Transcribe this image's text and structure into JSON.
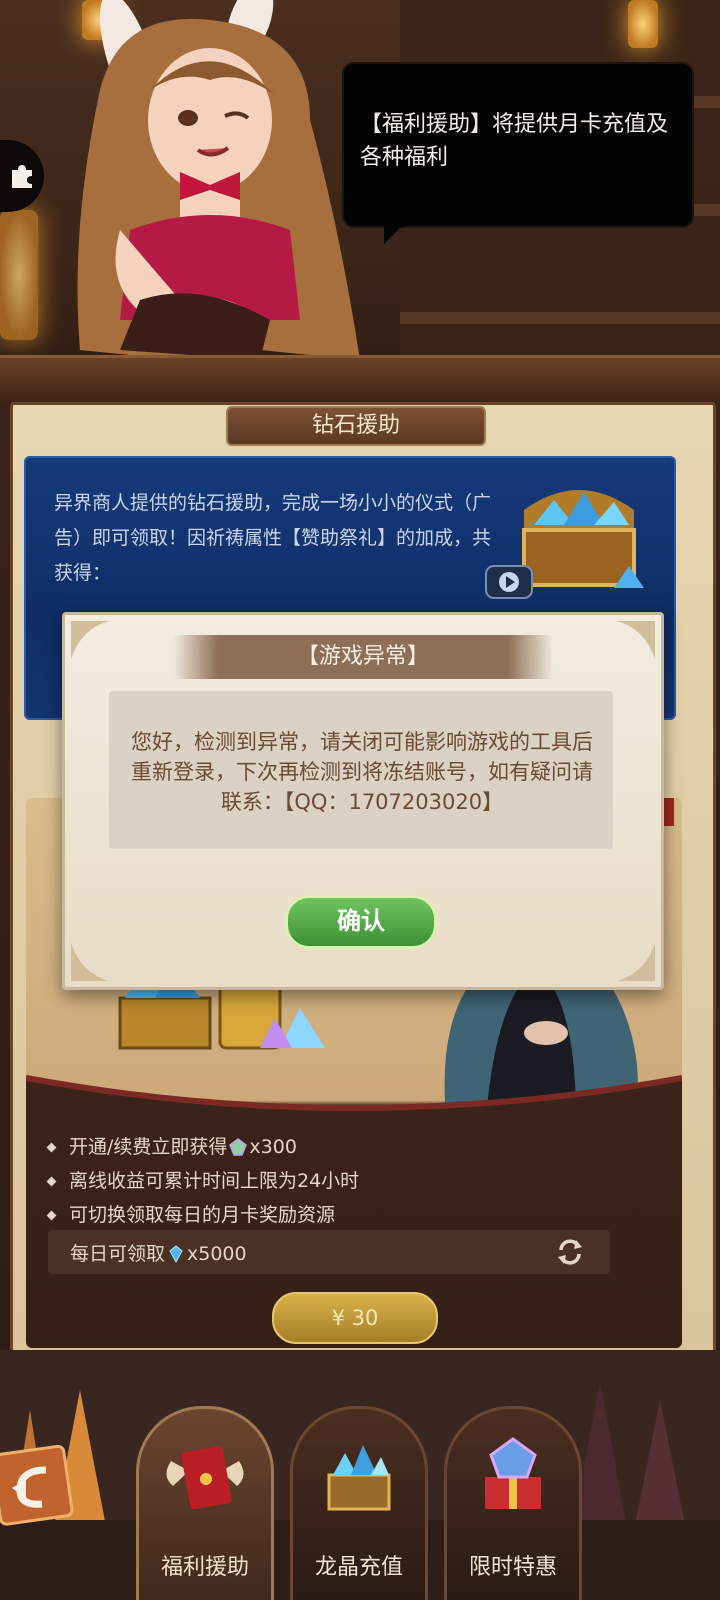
{
  "speech_bubble": {
    "text": "【福利援助】将提供月卡充值及各种福利"
  },
  "section_tag": {
    "label": "钻石援助"
  },
  "diamond_card": {
    "description": "异界商人提供的钻石援助，完成一场小小的仪式（广告）即可领取！因祈祷属性【赞助祭礼】的加成，共获得："
  },
  "monthly_card": {
    "benefits": [
      {
        "text": "开通/续费立即获得",
        "suffix": "x300",
        "icon": "rainbow-gem-icon"
      },
      {
        "text": "离线收益可累计时间上限为24小时"
      },
      {
        "text": "可切换领取每日的月卡奖励资源"
      }
    ],
    "daily": {
      "text": "每日可领取",
      "suffix": "x5000",
      "icon": "blue-diamond-icon"
    },
    "price_label": "¥ 30"
  },
  "modal": {
    "title": "【游戏异常】",
    "message": "您好，检测到异常，请关闭可能影响游戏的工具后重新登录，下次再检测到将冻结账号，如有疑问请联系：【QQ：1707203020】",
    "confirm_label": "确认"
  },
  "bottom_nav": {
    "tabs": [
      {
        "label": "福利援助",
        "icon": "red-envelope-icon",
        "active": true
      },
      {
        "label": "龙晶充值",
        "icon": "crystal-chest-icon",
        "active": false
      },
      {
        "label": "限时特惠",
        "icon": "gift-gem-icon",
        "active": false
      }
    ]
  },
  "colors": {
    "confirm_green": "#4fa844",
    "gold_button": "#c49a36",
    "blue_card": "#123672"
  }
}
